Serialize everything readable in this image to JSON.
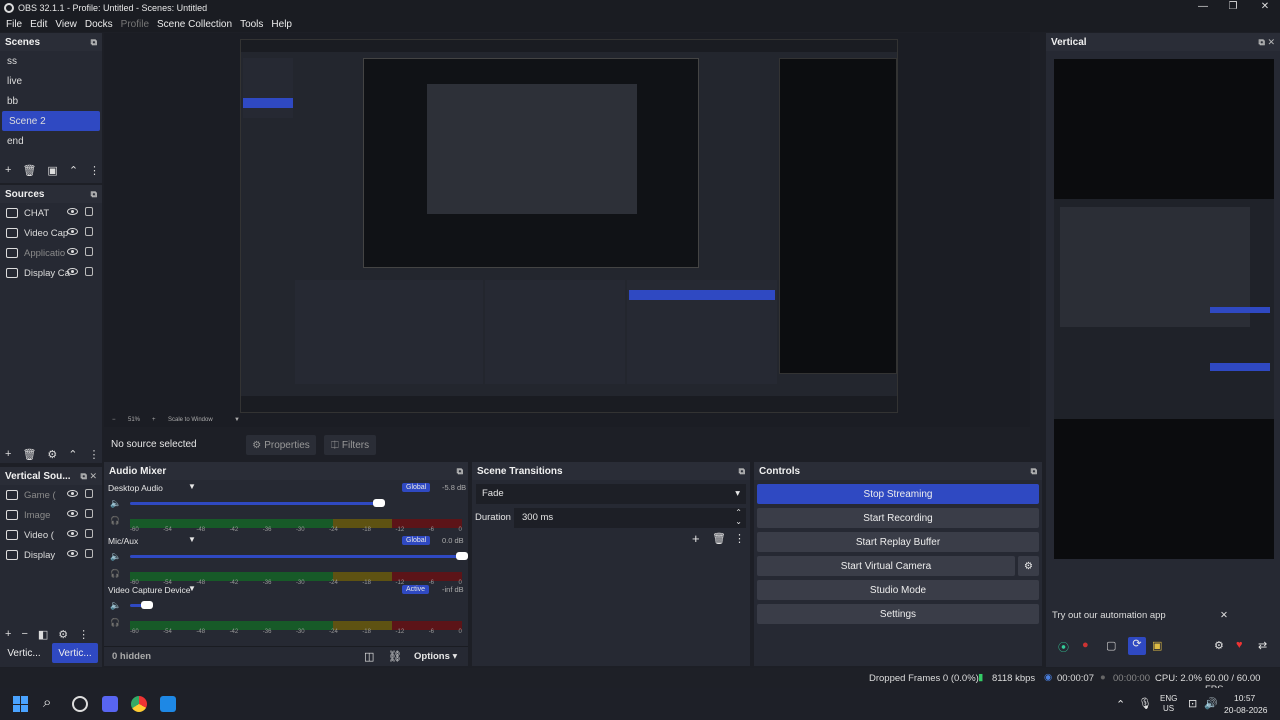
{
  "window": {
    "title": "OBS 32.1.1 - Profile: Untitled - Scenes: Untitled"
  },
  "menu": [
    "File",
    "Edit",
    "View",
    "Docks",
    "Profile",
    "Scene Collection",
    "Tools",
    "Help"
  ],
  "scenes": {
    "title": "Scenes",
    "items": [
      "ss",
      "live",
      "bb",
      "Scene 2",
      "end"
    ],
    "selected": 3
  },
  "sources": {
    "title": "Sources",
    "items": [
      "CHAT",
      "Video Cap",
      "Applicatio",
      "Display Ca"
    ]
  },
  "vsources": {
    "title": "Vertical Sou...",
    "items": [
      "Game (",
      "Image",
      "Video (",
      "Display"
    ]
  },
  "bottom_tabs": [
    "Vertic...",
    "Vertic..."
  ],
  "preview": {
    "zoom": "51%",
    "scale": "Scale to Window"
  },
  "context": {
    "no_source": "No source selected",
    "properties": "Properties",
    "filters": "Filters"
  },
  "mixer": {
    "title": "Audio Mixer",
    "channels": [
      {
        "name": "Desktop Audio",
        "badge": "Global",
        "db": "-5.8 dB",
        "level": 0.75
      },
      {
        "name": "Mic/Aux",
        "badge": "Global",
        "db": "0.0 dB",
        "level": 1.0
      },
      {
        "name": "Video Capture Device",
        "badge": "Active",
        "db": "-inf dB",
        "level": 0.05
      }
    ],
    "ticks": [
      "-60",
      "-54",
      "-48",
      "-42",
      "-36",
      "-30",
      "-24",
      "-18",
      "-12",
      "-6",
      "0"
    ],
    "hidden": "0 hidden",
    "options": "Options"
  },
  "transitions": {
    "title": "Scene Transitions",
    "value": "Fade",
    "duration_label": "Duration",
    "duration": "300 ms"
  },
  "controls": {
    "title": "Controls",
    "stop_streaming": "Stop Streaming",
    "start_recording": "Start Recording",
    "replay": "Start Replay Buffer",
    "virtual_cam": "Start Virtual Camera",
    "studio": "Studio Mode",
    "settings": "Settings"
  },
  "vertical": {
    "title": "Vertical",
    "automation": "Try out our automation app"
  },
  "status": {
    "dropped": "Dropped Frames 0 (0.0%)",
    "kbps": "8118 kbps",
    "stream_time": "00:00:07",
    "rec_time": "00:00:00",
    "cpu": "CPU: 2.0%",
    "fps": "60.00 / 60.00 FPS"
  },
  "taskbar": {
    "lang1": "ENG",
    "lang2": "US",
    "time": "10:57",
    "date": "20-08-2026"
  }
}
